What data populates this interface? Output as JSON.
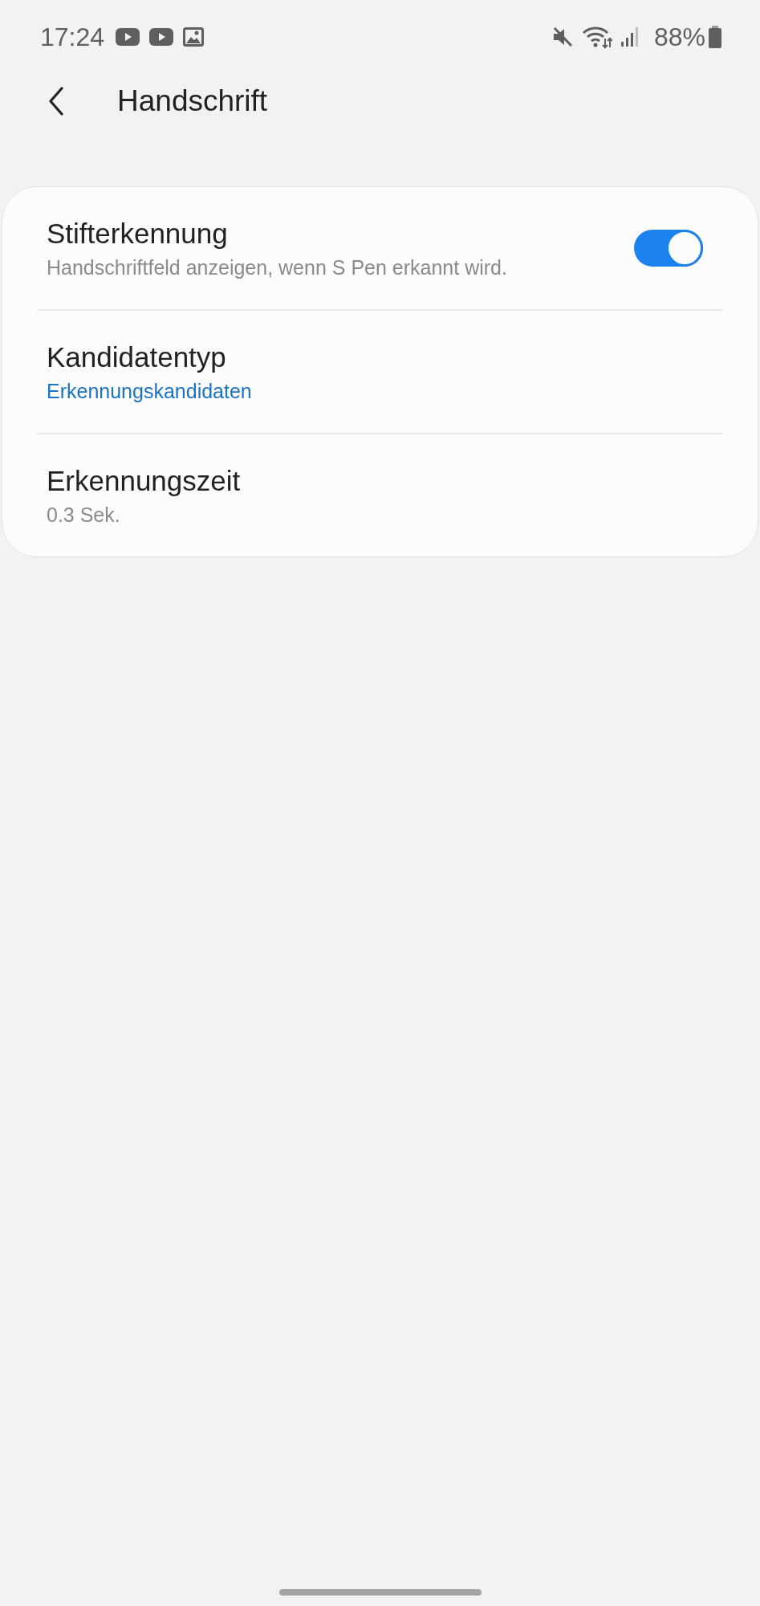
{
  "status_bar": {
    "time": "17:24",
    "battery": "88%"
  },
  "header": {
    "title": "Handschrift"
  },
  "settings": [
    {
      "kind": "toggle",
      "title": "Stifterkennung",
      "summary": "Handschriftfeld anzeigen, wenn S Pen erkannt wird.",
      "on": true
    },
    {
      "kind": "list",
      "title": "Kandidatentyp",
      "summary": "Erkennungskandidaten"
    },
    {
      "kind": "value",
      "title": "Erkennungszeit",
      "summary": "0.3 Sek."
    }
  ]
}
